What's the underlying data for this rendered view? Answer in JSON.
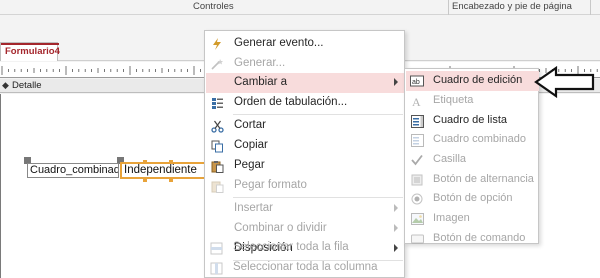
{
  "ribbon": {
    "groups": [
      "Controles",
      "Encabezado y pie de página"
    ]
  },
  "document_tab": {
    "label": "Formulario4"
  },
  "section": {
    "label": "Detalle"
  },
  "form_controls": {
    "label_text": "Cuadro_combinado",
    "textbox_text": "Independiente"
  },
  "context_menu": {
    "items": [
      {
        "label": "Generar evento...",
        "icon": "lightning-icon",
        "disabled": false,
        "submenu": false
      },
      {
        "label": "Generar...",
        "icon": "wand-icon",
        "disabled": true,
        "submenu": false
      },
      {
        "label": "Cambiar a",
        "icon": "",
        "disabled": false,
        "submenu": true,
        "highlighted": true
      },
      {
        "label": "Orden de tabulación...",
        "icon": "tab-order-icon",
        "disabled": false,
        "submenu": false
      },
      {
        "label": "Cortar",
        "icon": "scissors-icon",
        "disabled": false,
        "submenu": false
      },
      {
        "label": "Copiar",
        "icon": "copy-icon",
        "disabled": false,
        "submenu": false
      },
      {
        "label": "Pegar",
        "icon": "paste-icon",
        "disabled": false,
        "submenu": false
      },
      {
        "label": "Pegar formato",
        "icon": "paste-format-icon",
        "disabled": true,
        "submenu": false
      },
      {
        "label": "Insertar",
        "icon": "",
        "disabled": true,
        "submenu": true
      },
      {
        "label": "Combinar o dividir",
        "icon": "",
        "disabled": true,
        "submenu": true
      },
      {
        "label": "Disposición",
        "icon": "",
        "disabled": false,
        "submenu": true
      },
      {
        "label": "Seleccionar toda la fila",
        "icon": "select-row-icon",
        "disabled": true,
        "submenu": false
      },
      {
        "label": "Seleccionar toda la columna",
        "icon": "select-column-icon",
        "disabled": true,
        "submenu": false
      }
    ]
  },
  "submenu": {
    "items": [
      {
        "label": "Cuadro de edición",
        "icon": "textbox-icon",
        "disabled": false,
        "highlighted": true
      },
      {
        "label": "Etiqueta",
        "icon": "label-icon",
        "disabled": true
      },
      {
        "label": "Cuadro de lista",
        "icon": "listbox-icon",
        "disabled": false
      },
      {
        "label": "Cuadro combinado",
        "icon": "combobox-icon",
        "disabled": true
      },
      {
        "label": "Casilla",
        "icon": "checkbox-icon",
        "disabled": true
      },
      {
        "label": "Botón de alternancia",
        "icon": "toggle-button-icon",
        "disabled": true
      },
      {
        "label": "Botón de opción",
        "icon": "option-button-icon",
        "disabled": true
      },
      {
        "label": "Imagen",
        "icon": "image-icon",
        "disabled": true
      },
      {
        "label": "Botón de comando",
        "icon": "command-button-icon",
        "disabled": true
      }
    ]
  },
  "colors": {
    "accent": "#a4262c",
    "highlight": "#f8dcdc",
    "selection": "#e8a33a"
  }
}
